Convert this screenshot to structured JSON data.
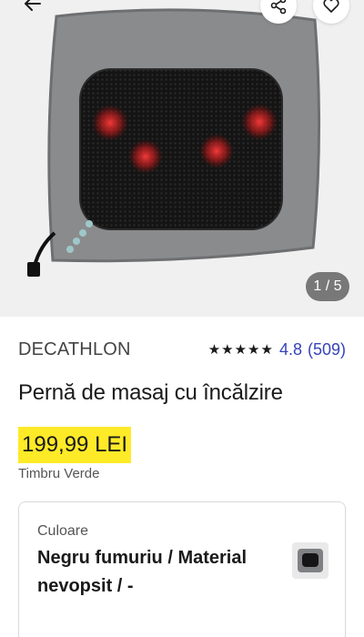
{
  "gallery": {
    "counter": "1 / 5",
    "icons": {
      "back": "arrow-left-icon",
      "share": "share-icon",
      "favorite": "heart-icon"
    }
  },
  "product": {
    "brand": "DECATHLON",
    "stars": "★★★★★",
    "rating": "4.8",
    "reviews": "(509)",
    "title": "Pernă de masaj cu încălzire",
    "price": "199,99 LEI",
    "stamp_note": "Timbru Verde"
  },
  "variant": {
    "label": "Culoare",
    "value": "Negru fumuriu / Material nevopsit / -"
  },
  "colors": {
    "accent": "#3643ba",
    "price_highlight": "#ffea28"
  }
}
